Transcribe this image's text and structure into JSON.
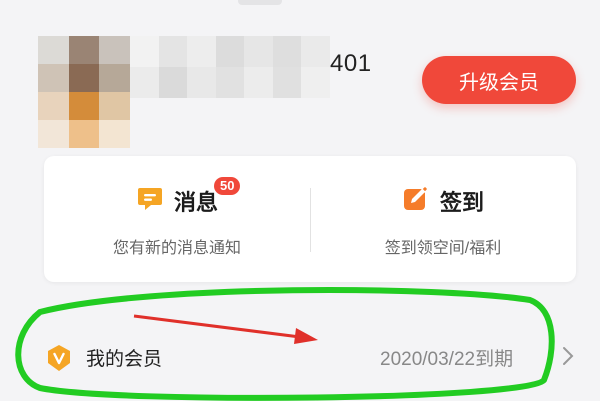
{
  "profile": {
    "username_visible_suffix": "401",
    "upgrade_button": "升级会员"
  },
  "quick_actions": {
    "messages": {
      "title": "消息",
      "badge": "50",
      "subtitle": "您有新的消息通知",
      "icon": "message-icon",
      "icon_color": "#f5a524"
    },
    "checkin": {
      "title": "签到",
      "subtitle": "签到领空间/福利",
      "icon": "checkin-edit-icon",
      "icon_color": "#f57c2a"
    }
  },
  "membership": {
    "label": "我的会员",
    "expiry": "2020/03/22到期",
    "icon": "vip-shield-icon",
    "icon_color": "#f5a524"
  },
  "colors": {
    "accent": "#f0483a",
    "annotation_circle": "#22cc22",
    "annotation_arrow": "#e0302a"
  }
}
